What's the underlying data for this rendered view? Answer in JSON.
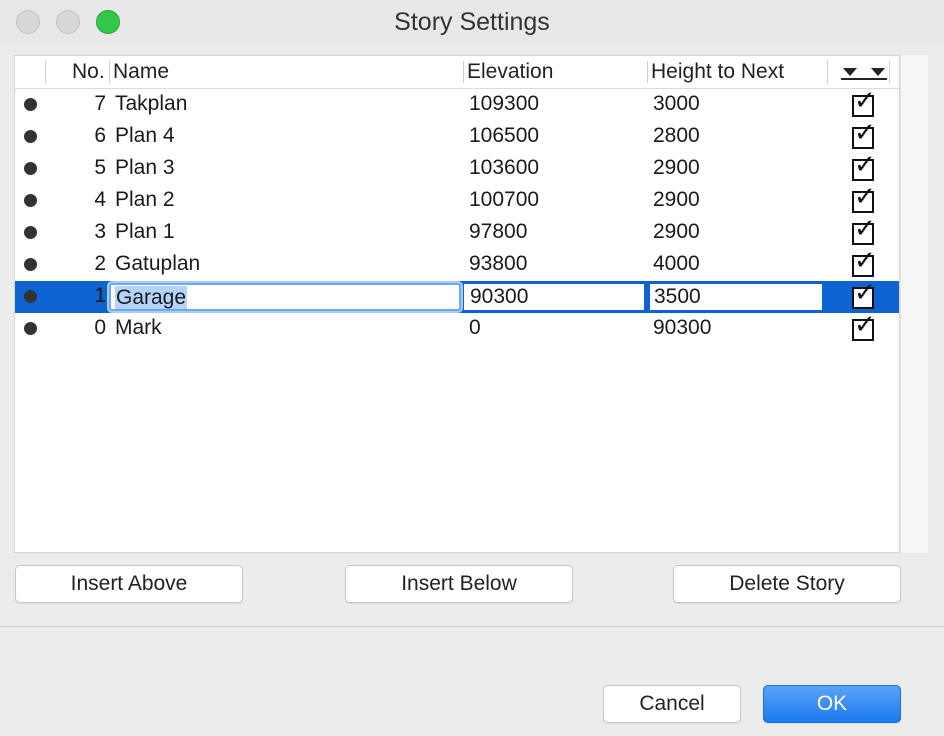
{
  "window": {
    "title": "Story Settings"
  },
  "table": {
    "headers": {
      "no": "No.",
      "name": "Name",
      "elevation": "Elevation",
      "height_to_next": "Height to Next"
    },
    "rows": [
      {
        "no": "7",
        "name": "Takplan",
        "elevation": "109300",
        "height_to_next": "3000",
        "show": true
      },
      {
        "no": "6",
        "name": "Plan 4",
        "elevation": "106500",
        "height_to_next": "2800",
        "show": true
      },
      {
        "no": "5",
        "name": "Plan 3",
        "elevation": "103600",
        "height_to_next": "2900",
        "show": true
      },
      {
        "no": "4",
        "name": "Plan 2",
        "elevation": "100700",
        "height_to_next": "2900",
        "show": true
      },
      {
        "no": "3",
        "name": "Plan 1",
        "elevation": "97800",
        "height_to_next": "2900",
        "show": true
      },
      {
        "no": "2",
        "name": "Gatuplan",
        "elevation": "93800",
        "height_to_next": "4000",
        "show": true
      },
      {
        "no": "1",
        "name": "Garage",
        "elevation": "90300",
        "height_to_next": "3500",
        "show": true,
        "selected": true
      },
      {
        "no": "0",
        "name": "Mark",
        "elevation": "0",
        "height_to_next": "90300",
        "show": true
      }
    ]
  },
  "buttons": {
    "insert_above": "Insert Above",
    "insert_below": "Insert Below",
    "delete_story": "Delete Story",
    "cancel": "Cancel",
    "ok": "OK"
  },
  "colors": {
    "selection": "#0e63d2",
    "zoom_button": "#34c749",
    "primary_button": "#1b79f0"
  }
}
